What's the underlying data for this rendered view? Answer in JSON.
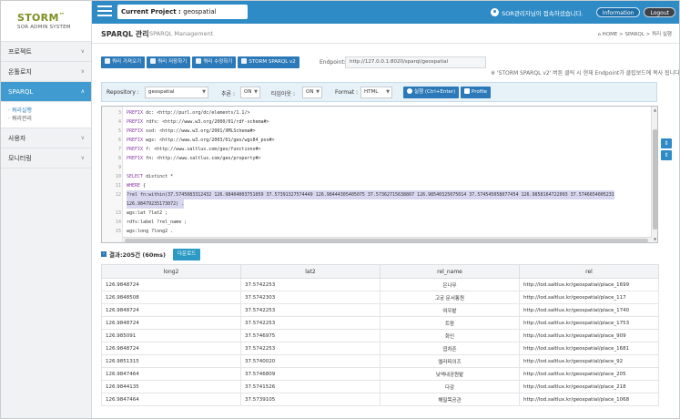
{
  "app": {
    "logo_main": "STORM",
    "logo_tm": "™",
    "logo_sub": "SOR ADMIN SYSTEM"
  },
  "topbar": {
    "project_label": "Current Project : ",
    "project_value": "geospatial",
    "welcome": "SOR관리자님이 접속하셨습니다.",
    "info_label": "Information",
    "logout_label": "Logout"
  },
  "sidebar": {
    "items": [
      {
        "label": "프로젝트"
      },
      {
        "label": "온톨로지"
      },
      {
        "label": "SPARQL"
      },
      {
        "label": "사용자"
      },
      {
        "label": "모니터링"
      }
    ],
    "sub_items": [
      {
        "label": "· 쿼리실행"
      },
      {
        "label": "· 쿼리관리"
      }
    ]
  },
  "page": {
    "title": "SPARQL 관리",
    "subtitle": "SPARQL Management",
    "breadcrumb": "⌂ HOME > SPARQL > 쿼리 실행"
  },
  "toolbar": {
    "buttons": [
      {
        "label": "쿼리 가져오기"
      },
      {
        "label": "쿼리 저장하기"
      },
      {
        "label": "쿼리 수정하기"
      },
      {
        "label": "STORM SPARQL v2"
      }
    ],
    "endpoint_label": "Endpoint:",
    "endpoint_value": "http://127.0.0.1:8020/sparql/geospatial",
    "endpoint_note": "※ 'STORM SPARQL v2' 버튼 클릭 시 현재 Endpoint가 클립보드에 복사 됩니다."
  },
  "options": {
    "repository_label": "Repository :",
    "repository_value": "geospatial",
    "inference_label": "추론 :",
    "inference_value": "ON",
    "timeout_label": "타임아웃 :",
    "timeout_value": "ON",
    "format_label": "Format :",
    "format_value": "HTML",
    "run_label": "실행 (Ctrl+Enter)",
    "profile_label": "Profile"
  },
  "editor": {
    "lines": [
      {
        "n": "3",
        "kw": "PREFIX",
        "t": " dc: <http://purl.org/dc/elements/1.1/>"
      },
      {
        "n": "4",
        "kw": "PREFIX",
        "t": " rdfs: <http://www.w3.org/2000/01/rdf-schema#>"
      },
      {
        "n": "5",
        "kw": "PREFIX",
        "t": " xsd: <http://www.w3.org/2001/XMLSchema#>"
      },
      {
        "n": "6",
        "kw": "PREFIX",
        "t": " wgs: <http://www.w3.org/2003/01/geo/wgs84_pos#>"
      },
      {
        "n": "7",
        "kw": "PREFIX",
        "t": " f: <http://www.saltlux.com/geo/functions#>"
      },
      {
        "n": "8",
        "kw": "PREFIX",
        "t": " fn: <http://www.saltlux.com/geo/property#>"
      },
      {
        "n": "9",
        "kw": "",
        "t": ""
      },
      {
        "n": "10",
        "kw": "SELECT",
        "t": " distinct *"
      },
      {
        "n": "11",
        "kw": "WHERE",
        "t": " {"
      },
      {
        "n": "12",
        "kw": "",
        "t": "  ?rel fn:within(37.5745083312432 126.98404003751059 37.57391327574449 126.98444305405075 37.57362715638807 126.98540325075014 37.574545058077454 126.9858164722093 37.5746654005231"
      },
      {
        "n": "",
        "kw": "",
        "t": "  126.98479235173072) ."
      },
      {
        "n": "13",
        "kw": "",
        "t": "    wgs:lat ?lat2 ;"
      },
      {
        "n": "14",
        "kw": "",
        "t": "    rdfs:label ?rel_name ;"
      },
      {
        "n": "15",
        "kw": "",
        "t": "    wgs:long ?long2 ."
      }
    ]
  },
  "result": {
    "summary": "결과:205건 (60ms)",
    "download_label": "다운로드",
    "columns": [
      "long2",
      "lat2",
      "rel_name",
      "rel"
    ],
    "rows": [
      [
        "126.9848724",
        "37.5742253",
        "은나무",
        "http://lod.saltlux.kr/geospatial/place_1699"
      ],
      [
        "126.9848508",
        "37.5742303",
        "고궁 문서통원",
        "http://lod.saltlux.kr/geospatial/place_117"
      ],
      [
        "126.9848724",
        "37.5742253",
        "여우밭",
        "http://lod.saltlux.kr/geospatial/place_1740"
      ],
      [
        "126.9848724",
        "37.5742253",
        "트람",
        "http://lod.saltlux.kr/geospatial/place_1753"
      ],
      [
        "126.985091",
        "37.5746975",
        "화인",
        "http://lod.saltlux.kr/geospatial/place_909"
      ],
      [
        "126.9848724",
        "37.5742253",
        "엽차존",
        "http://lod.saltlux.kr/geospatial/place_1681"
      ],
      [
        "126.9851315",
        "37.5740020",
        "엘라피이즈",
        "http://lod.saltlux.kr/geospatial/place_92"
      ],
      [
        "126.9847464",
        "37.5746809",
        "낮액내공원밭",
        "http://lod.saltlux.kr/geospatial/place_205"
      ],
      [
        "126.9844135",
        "37.5741526",
        "다감",
        "http://lod.saltlux.kr/geospatial/place_218"
      ],
      [
        "126.9847464",
        "37.5739105",
        "해밀목공관",
        "http://lod.saltlux.kr/geospatial/place_1068"
      ]
    ]
  },
  "colors": {
    "topbar": "#2e8bc6",
    "sidebar_active": "#3f9bd0",
    "button": "#2b79b8",
    "logo": "#7c8f23"
  }
}
